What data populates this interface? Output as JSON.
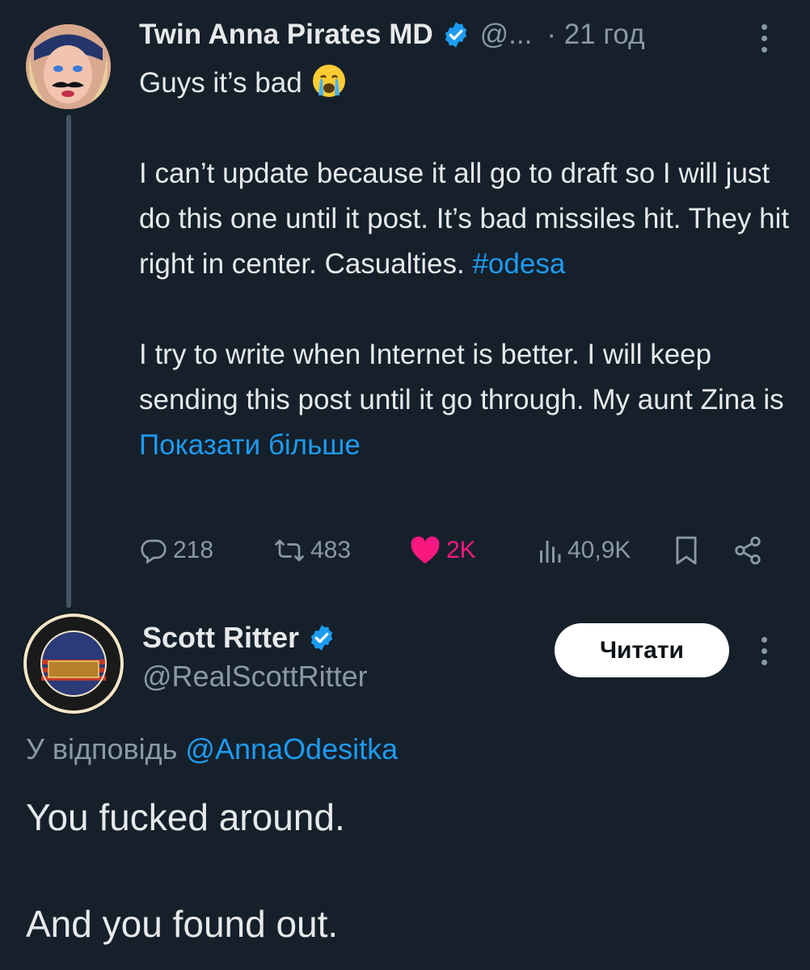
{
  "tweet": {
    "author": {
      "display_name": "Twin Anna Pirates MD",
      "handle": "@...",
      "verified_icon": "verified-badge-icon"
    },
    "time": "· 21 год",
    "text": {
      "line1": "Guys it’s bad",
      "para2": "I can’t update because it all go to draft so I will just do this one until it post. It’s bad missiles hit. They hit right in center. Casualties.",
      "hashtag": "#odesa",
      "para3": "I try to write when Internet is better. I will keep sending this post until it go through. My aunt Zina is",
      "show_more": "Показати більше"
    },
    "stats": {
      "replies": "218",
      "reposts": "483",
      "likes": "2K",
      "views": "40,9K"
    }
  },
  "reply": {
    "author": {
      "display_name": "Scott Ritter",
      "handle": "@RealScottRitter"
    },
    "follow_label": "Читати",
    "reply_to_prefix": "У відповідь",
    "reply_to_handle": "@AnnaOdesitka",
    "text_line1": "You fucked around.",
    "text_line2": "And you found out."
  },
  "colors": {
    "background": "#15202b",
    "link": "#1d9bf0",
    "muted": "#8b98a5",
    "like": "#f91880"
  }
}
